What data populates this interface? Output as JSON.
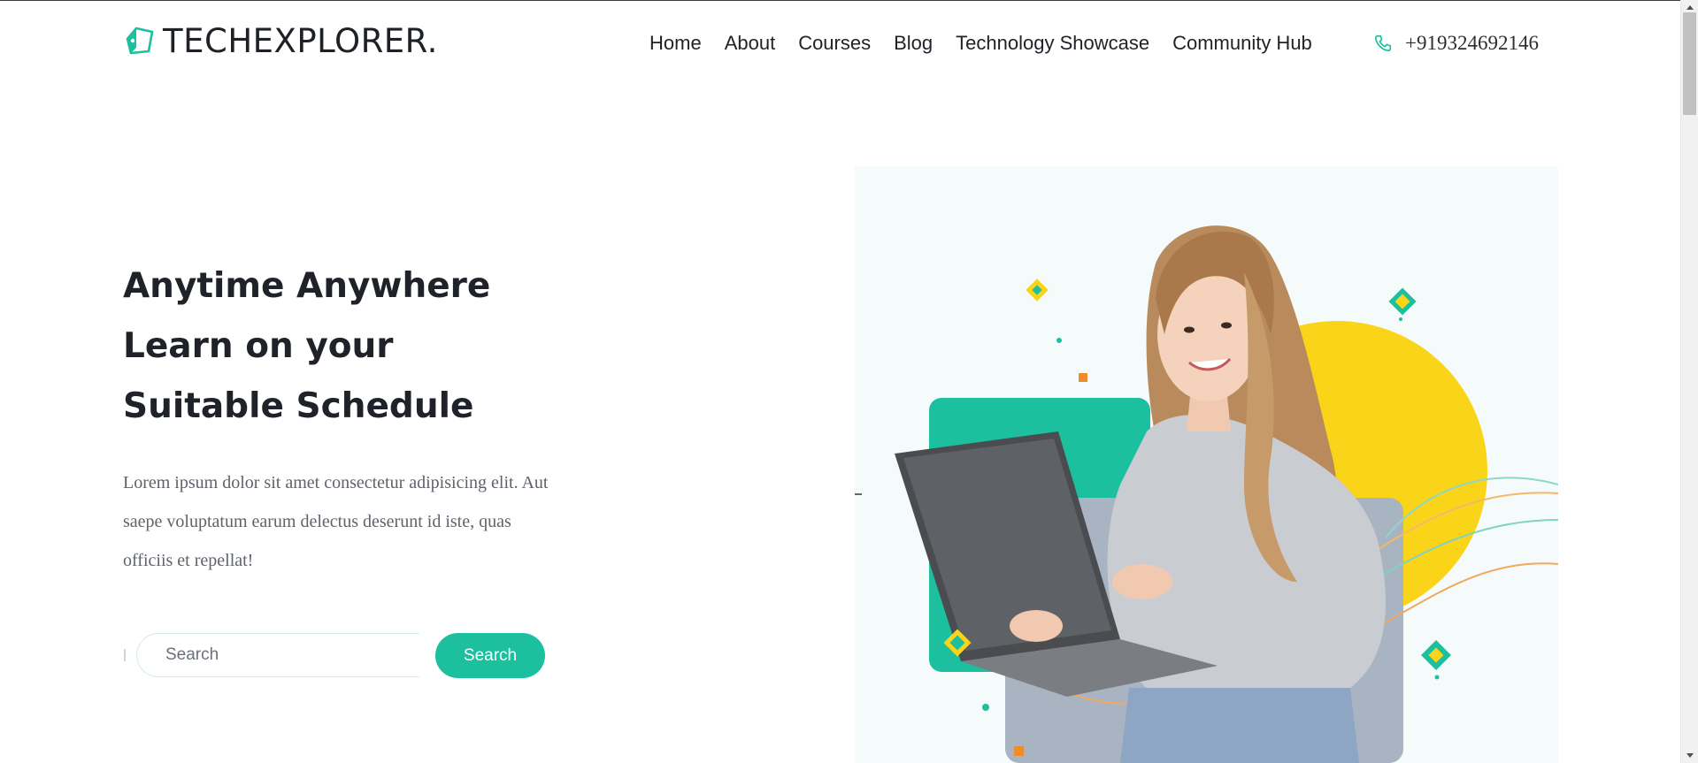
{
  "brand": {
    "name": "TECHEXPLORER.",
    "icon": "logo-tag-icon",
    "accent": "#1cbf9e"
  },
  "nav": {
    "items": [
      {
        "label": "Home"
      },
      {
        "label": "About"
      },
      {
        "label": "Courses"
      },
      {
        "label": "Blog"
      },
      {
        "label": "Technology Showcase"
      },
      {
        "label": "Community Hub"
      }
    ]
  },
  "contact": {
    "phone": "+919324692146",
    "icon": "phone-icon"
  },
  "hero": {
    "title_lines": [
      "Anytime Anywhere",
      "Learn on your",
      "Suitable Schedule"
    ],
    "description": "Lorem ipsum dolor sit amet consectetur adipisicing elit. Aut saepe voluptatum earum delectus deserunt id iste, quas officiis et repellat!",
    "image_alt": "woman-holding-laptop-illustration"
  },
  "search": {
    "placeholder": "Search",
    "button_label": "Search"
  },
  "colors": {
    "teal": "#1cbf9e",
    "yellow": "#fad418",
    "text": "#1f2228",
    "muted": "#5e636b"
  }
}
